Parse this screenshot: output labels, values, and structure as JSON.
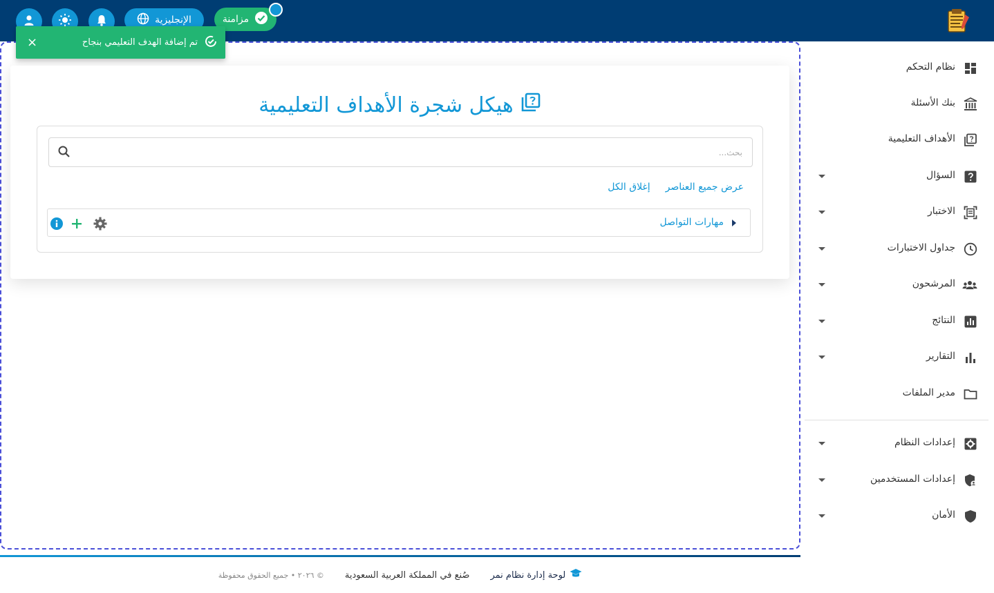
{
  "header": {
    "sync_label": "مزامنة",
    "language_label": "الإنجليزية",
    "icons": [
      "exam-logo-icon",
      "check-circle-icon",
      "globe-icon",
      "sun-icon",
      "bell-icon",
      "user-icon"
    ]
  },
  "toast": {
    "message": "تم إضافة الهدف التعليمي بنجاح",
    "close": "×"
  },
  "main": {
    "title": "هيكل شجرة الأهداف التعليمية",
    "search_placeholder": "بحث...",
    "show_all": "عرض جميع العناصر",
    "collapse_all": "إغلاق الكل",
    "tree": [
      {
        "label": "مهارات التواصل"
      }
    ]
  },
  "sidebar": {
    "items": [
      {
        "label": "نظام التحكم",
        "icon": "dashboard-icon"
      },
      {
        "label": "بنك الأسئلة",
        "icon": "bank-icon"
      },
      {
        "label": "الأهداف التعليمية",
        "icon": "objectives-icon"
      },
      {
        "label": "السؤال",
        "icon": "question-icon"
      },
      {
        "label": "الاختبار",
        "icon": "exam-icon"
      },
      {
        "label": "جداول الاختبارات",
        "icon": "clock-icon"
      },
      {
        "label": "المرشحون",
        "icon": "users-icon"
      },
      {
        "label": "النتائج",
        "icon": "results-icon"
      },
      {
        "label": "التقارير",
        "icon": "reports-icon"
      },
      {
        "label": "مدير الملفات",
        "icon": "folder-icon"
      },
      {
        "label": "إعدادات النظام",
        "icon": "settings-icon"
      },
      {
        "label": "إعدادات المستخدمين",
        "icon": "user-settings-icon"
      },
      {
        "label": "الأمان",
        "icon": "shield-icon"
      }
    ]
  },
  "footer": {
    "brand": "لوحة إدارة نظام نمر",
    "made_in": "صُنع في المملكة العربية السعودية",
    "copyright": "© ٢٠٢٦ • جميع الحقوق محفوظة"
  },
  "colors": {
    "topbar": "#003d73",
    "accent": "#1297d6",
    "success": "#22b573",
    "frame": "#4a4fd8"
  }
}
